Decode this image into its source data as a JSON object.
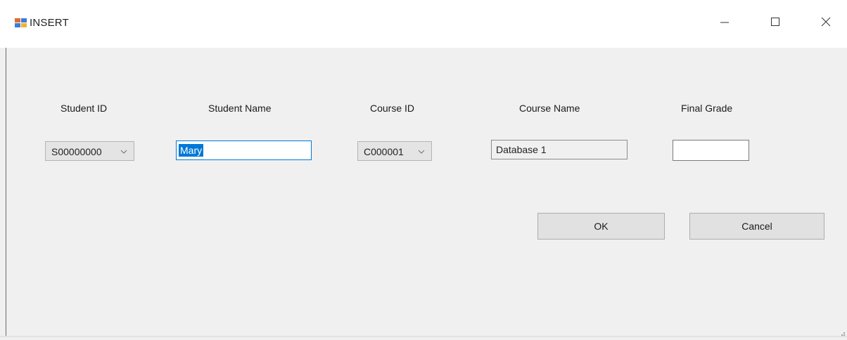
{
  "window": {
    "title": "INSERT"
  },
  "form": {
    "student_id": {
      "label": "Student ID",
      "value": "S00000000"
    },
    "student_name": {
      "label": "Student Name",
      "value": "Mary"
    },
    "course_id": {
      "label": "Course ID",
      "value": "C000001"
    },
    "course_name": {
      "label": "Course Name",
      "value": "Database 1"
    },
    "final_grade": {
      "label": "Final Grade",
      "value": ""
    }
  },
  "buttons": {
    "ok": "OK",
    "cancel": "Cancel"
  },
  "colors": {
    "accent": "#0078d7",
    "window_bg": "#f0f0f0",
    "titlebar_bg": "#ffffff"
  }
}
